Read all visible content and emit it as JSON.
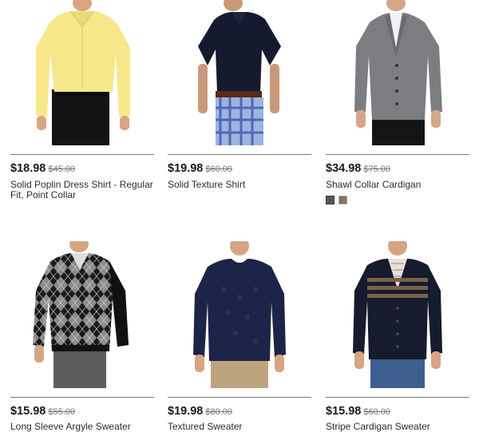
{
  "products": [
    {
      "price": "$18.98",
      "was": "$45.00",
      "title": "Solid Poplin Dress Shirt - Regular Fit, Point Collar",
      "image_icon": "yellow-dress-shirt-photo"
    },
    {
      "price": "$19.98",
      "was": "$60.00",
      "title": "Solid Texture Shirt",
      "image_icon": "navy-polo-shirt-photo"
    },
    {
      "price": "$34.98",
      "was": "$75.00",
      "title": "Shawl Collar Cardigan",
      "image_icon": "gray-shawl-cardigan-photo",
      "swatches": [
        {
          "color": "#55595e",
          "name": "gray"
        },
        {
          "color": "#8a7358",
          "name": "brown"
        }
      ]
    },
    {
      "price": "$15.98",
      "was": "$55.00",
      "title": "Long Sleeve Argyle Sweater",
      "image_icon": "argyle-sweater-photo"
    },
    {
      "price": "$19.98",
      "was": "$80.00",
      "title": "Textured Sweater",
      "image_icon": "navy-textured-sweater-photo"
    },
    {
      "price": "$15.98",
      "was": "$60.00",
      "title": "Stripe Cardigan Sweater",
      "image_icon": "stripe-cardigan-photo"
    }
  ],
  "colors": {
    "price": "#1a1a1a",
    "strike": "#777777",
    "rule": "#777777"
  }
}
